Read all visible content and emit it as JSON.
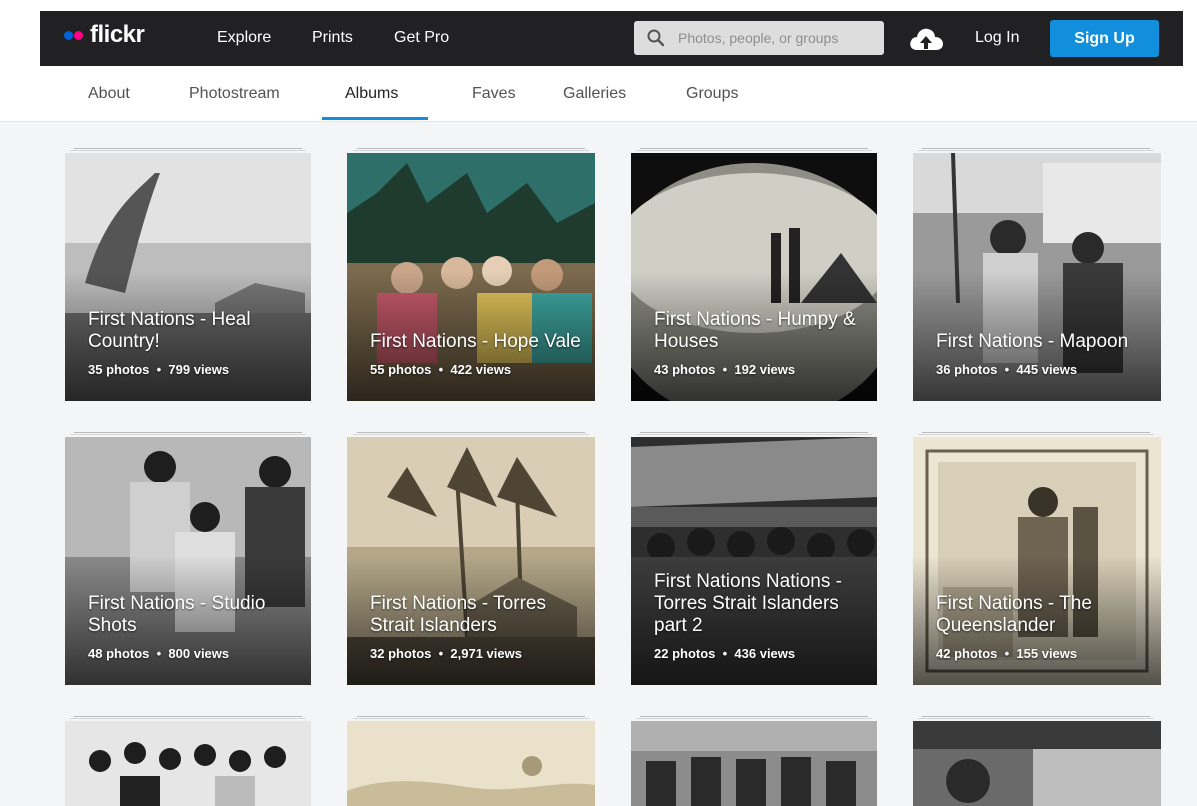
{
  "brand": {
    "name": "flickr",
    "dot_colors": [
      "#0063dc",
      "#ff0084"
    ]
  },
  "nav": {
    "links": [
      "Explore",
      "Prints",
      "Get Pro"
    ],
    "login": "Log In",
    "signup": "Sign Up"
  },
  "search": {
    "placeholder": "Photos, people, or groups"
  },
  "tabs": [
    "About",
    "Photostream",
    "Albums",
    "Faves",
    "Galleries",
    "Groups"
  ],
  "active_tab": "Albums",
  "albums": [
    {
      "title": "First Nations - Heal Country!",
      "photos": "35 photos",
      "views": "799 views"
    },
    {
      "title": "First Nations - Hope Vale",
      "photos": "55 photos",
      "views": "422 views"
    },
    {
      "title": "First Nations - Humpy & Houses",
      "photos": "43 photos",
      "views": "192 views"
    },
    {
      "title": "First Nations - Mapoon",
      "photos": "36 photos",
      "views": "445 views"
    },
    {
      "title": "First Nations - Studio Shots",
      "photos": "48 photos",
      "views": "800 views"
    },
    {
      "title": "First Nations - Torres Strait Islanders",
      "photos": "32 photos",
      "views": "2,971 views"
    },
    {
      "title": "First Nations Nations - Torres Strait Islanders part 2",
      "photos": "22 photos",
      "views": "436 views"
    },
    {
      "title": "First Nations - The Queenslander",
      "photos": "42 photos",
      "views": "155 views"
    }
  ],
  "colors": {
    "accent": "#128fdc",
    "navbar": "#212124"
  }
}
